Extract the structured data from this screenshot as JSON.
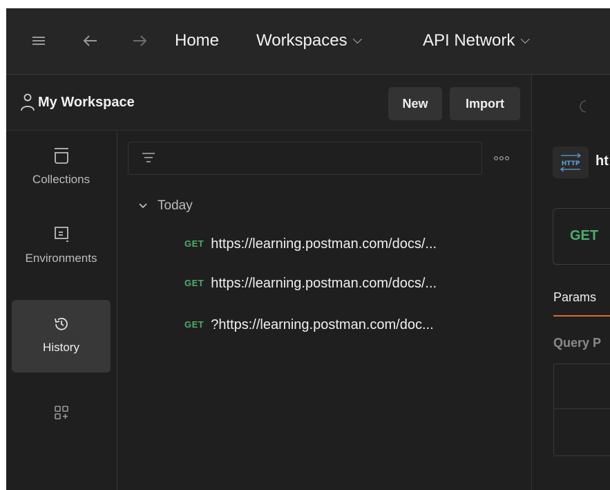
{
  "topbar": {
    "icons": [
      "hamburger-menu-icon",
      "arrow-left-icon",
      "arrow-right-icon"
    ],
    "home": "Home",
    "workspaces": "Workspaces",
    "api_network": "API Network"
  },
  "workspace": {
    "name": "My Workspace",
    "new_label": "New",
    "import_label": "Import"
  },
  "sidebar": {
    "items": [
      {
        "label": "Collections",
        "icon": "collections-icon"
      },
      {
        "label": "Environments",
        "icon": "environments-icon"
      },
      {
        "label": "History",
        "icon": "history-icon",
        "active": true
      },
      {
        "label": "",
        "icon": "add-widgets-icon"
      }
    ]
  },
  "history": {
    "filter_placeholder": "",
    "group_label": "Today",
    "rows": [
      {
        "method": "GET",
        "url": "https://learning.postman.com/docs/..."
      },
      {
        "method": "GET",
        "url": "https://learning.postman.com/docs/..."
      },
      {
        "method": "GET",
        "url": "?https://learning.postman.com/doc..."
      }
    ]
  },
  "request": {
    "tab_prefix": "ht",
    "method": "GET",
    "params_tab": "Params",
    "query_label": "Query P"
  },
  "colors": {
    "background": "#1f1f1f",
    "get_method": "#4caf6e",
    "active_tab_underline": "#e06a2c"
  }
}
